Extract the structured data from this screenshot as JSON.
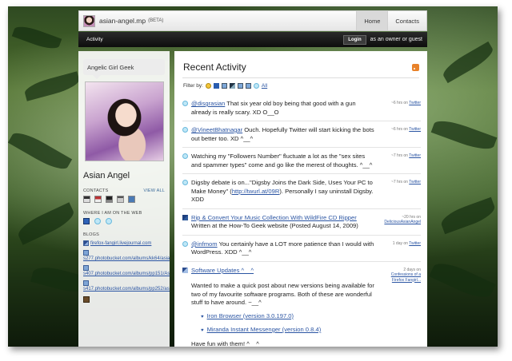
{
  "site": {
    "name": "asian-angel.mp",
    "beta": "(BETA)"
  },
  "nav": {
    "home": "Home",
    "contacts": "Contacts"
  },
  "subbar": {
    "activity": "Activity",
    "login": "Login",
    "guest_text": "as an owner or guest"
  },
  "sidebar": {
    "tagline": "Angelic Girl Geek",
    "name": "Asian Angel",
    "contacts_heading": "CONTACTS",
    "view_all": "VIEW ALL",
    "web_heading": "WHERE I AM ON THE WEB",
    "blogs_heading": "BLOGS",
    "blogs": [
      "firefox-fangirl.livejournal.com",
      "s277.photobucket.com/albums/kk64/asian",
      "s407.photobucket.com/albums/pp151/Asi",
      "s417.photobucket.com/albums/pp252/asian"
    ]
  },
  "main": {
    "title": "Recent Activity",
    "filter_label": "Filter by:",
    "filter_all": "All",
    "entries": [
      {
        "icon": "twitter-icon",
        "handle": "@disgrasian",
        "text": " That six year old boy being that good with a gun already is really scary. XD O__O",
        "meta_time": "~6 hrs on",
        "meta_src": "Twitter"
      },
      {
        "icon": "twitter-icon",
        "handle": "@VineetBhatnagar",
        "text": " Ouch. Hopefully Twitter will start kicking the bots out better too. XD ^__^",
        "meta_time": "~6 hrs on",
        "meta_src": "Twitter"
      },
      {
        "icon": "twitter-icon",
        "handle": "",
        "text": "Watching my \"Followers Number\" fluctuate a lot as the \"sex sites and spammer types\" come and go like the merest of thoughts. ^__^",
        "meta_time": "~7 hrs on",
        "meta_src": "Twitter"
      },
      {
        "icon": "twitter-icon",
        "handle": "",
        "text_before": "Digsby debate is on...\"Digsby Joins the Dark Side, Uses Your PC to Make Money\" (",
        "link": "http://twurl.at/09R",
        "text_after": "). Personally I say uninstall Digsby. XDD",
        "meta_time": "~7 hrs on",
        "meta_src": "Twitter"
      },
      {
        "icon": "delicious-icon",
        "link": "Rip & Convert Your Music Collection With WildFire CD Ripper",
        "text": "Written at the How-To Geek website (Posted August 14, 2009)",
        "meta_time": "~20 hrs on",
        "meta_src": "DeliciousAsianAngel"
      },
      {
        "icon": "twitter-icon",
        "handle": "@infmom",
        "text": " You certainly have a LOT more patience than I would with WordPress. XDD ^__^",
        "meta_time": "1 day on",
        "meta_src": "Twitter"
      },
      {
        "icon": "pencil-icon",
        "link": "Software Updates ^__^",
        "intro": "Wanted to make a quick post about new versions being available for two of my favourite software programs. Both of these are wonderful stuff to have around. ~__^",
        "items": [
          "Iron Browser (version 3.0.197.0)",
          "Miranda Instant Messenger (version 0.8.4)"
        ],
        "outro": "Have fun with them! ^__^",
        "meta_time": "2 days on",
        "meta_src": "Confessions of a Firefox Fangirl..."
      }
    ]
  }
}
